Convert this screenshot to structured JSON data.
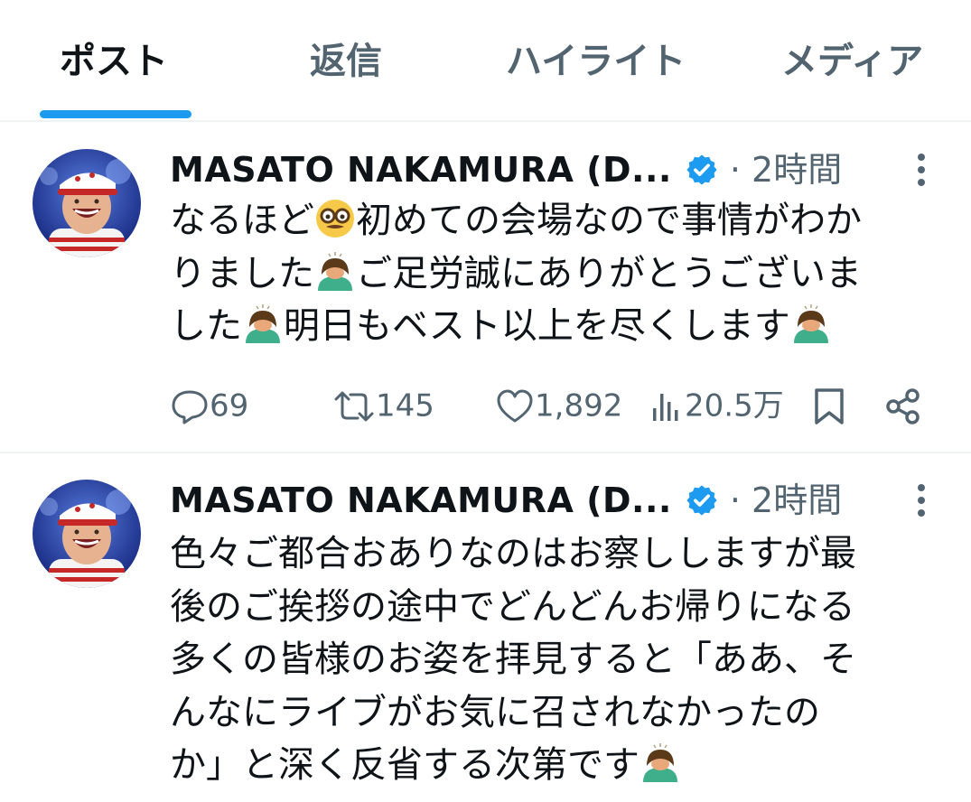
{
  "tabs": [
    {
      "label": "ポスト",
      "active": true
    },
    {
      "label": "返信",
      "active": false
    },
    {
      "label": "ハイライト",
      "active": false
    },
    {
      "label": "メディア",
      "active": false
    }
  ],
  "accent_color": "#1d9bf0",
  "posts": [
    {
      "author": "MASATO NAKAMURA (D...",
      "verified": true,
      "time": "· 2時間",
      "text_parts": [
        "なるほど",
        {
          "emoji": "nerd-face-with-glasses"
        },
        "初めての会場なので事情がわか\nりました",
        {
          "emoji": "man-bowing"
        },
        "ご足労誠にありがとうございま\nした",
        {
          "emoji": "man-bowing"
        },
        "明日もベスト以上を尽くします",
        {
          "emoji": "man-bowing"
        }
      ],
      "replies": "69",
      "reposts": "145",
      "likes": "1,892",
      "views": "20.5万"
    },
    {
      "author": "MASATO NAKAMURA (D...",
      "verified": true,
      "time": "· 2時間",
      "text_parts": [
        "色々ご都合おありなのはお察ししますが最\n後のご挨拶の途中でどんどんお帰りになる\n多くの皆様のお姿を拝見すると「ああ、そ\nんなにライブがお気に召されなかったの\nか」と深く反省する次第です",
        {
          "emoji": "man-bowing"
        }
      ]
    }
  ]
}
